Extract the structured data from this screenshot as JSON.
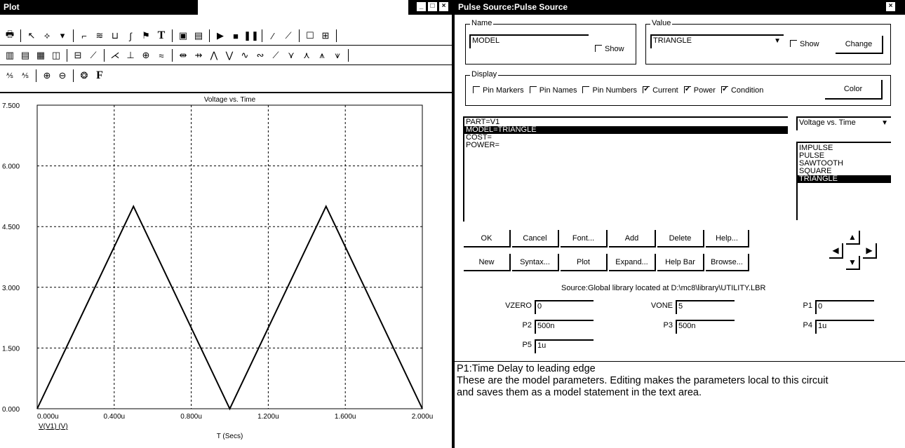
{
  "plot_window": {
    "title": "Plot",
    "min_glyph": "_",
    "max_glyph": "□",
    "close_glyph": "×"
  },
  "chart_data": {
    "type": "line",
    "title": "Voltage vs. Time",
    "xlabel": "T (Secs)",
    "ylabel": "",
    "series_label": "V(V1) (V)",
    "x_ticks": [
      "0.000u",
      "0.400u",
      "0.800u",
      "1.200u",
      "1.600u",
      "2.000u"
    ],
    "y_ticks": [
      "0.000",
      "1.500",
      "3.000",
      "4.500",
      "6.000",
      "7.500"
    ],
    "xlim": [
      0,
      2.0
    ],
    "ylim": [
      0,
      7.5
    ],
    "grid": true,
    "series": [
      {
        "x": [
          0,
          0.5,
          1.0,
          1.5,
          2.0
        ],
        "y": [
          0,
          5,
          0,
          5,
          0
        ]
      }
    ]
  },
  "dialog": {
    "title": "Pulse Source:Pulse Source",
    "close_glyph": "×",
    "name_group_label": "Name",
    "name_value": "MODEL",
    "name_show_label": "Show",
    "value_group_label": "Value",
    "value_value": "TRIANGLE",
    "value_show_label": "Show",
    "change_label": "Change",
    "display_group_label": "Display",
    "display_options": [
      {
        "label": "Pin Markers",
        "checked": false
      },
      {
        "label": "Pin Names",
        "checked": false
      },
      {
        "label": "Pin Numbers",
        "checked": false
      },
      {
        "label": "Current",
        "checked": true
      },
      {
        "label": "Power",
        "checked": true
      },
      {
        "label": "Condition",
        "checked": true
      }
    ],
    "color_label": "Color",
    "attributes": [
      "PART=V1",
      "MODEL=TRIANGLE",
      "COST=",
      "POWER="
    ],
    "selected_attribute": "MODEL=TRIANGLE",
    "plot_type_select": "Voltage vs. Time",
    "waveforms": [
      "IMPULSE",
      "PULSE",
      "SAWTOOTH",
      "SQUARE",
      "TRIANGLE"
    ],
    "selected_waveform": "TRIANGLE",
    "buttons_row1": [
      "OK",
      "Cancel",
      "Font...",
      "Add",
      "Delete",
      "Help..."
    ],
    "buttons_row2": [
      "New",
      "Syntax...",
      "Plot",
      "Expand...",
      "Help Bar",
      "Browse..."
    ],
    "source_text": "Source:Global library located at D:\\mc8\\library\\UTILITY.LBR",
    "params": [
      {
        "label": "VZERO",
        "value": "0"
      },
      {
        "label": "VONE",
        "value": "5"
      },
      {
        "label": "P1",
        "value": "0"
      },
      {
        "label": "P2",
        "value": "500n"
      },
      {
        "label": "P3",
        "value": "500n"
      },
      {
        "label": "P4",
        "value": "1u"
      },
      {
        "label": "P5",
        "value": "1u"
      }
    ],
    "help_line1": "P1:Time Delay to leading edge",
    "help_line2": "These are the model parameters. Editing makes the parameters local to this circuit",
    "help_line3": "and saves them as a model statement in the text area."
  }
}
